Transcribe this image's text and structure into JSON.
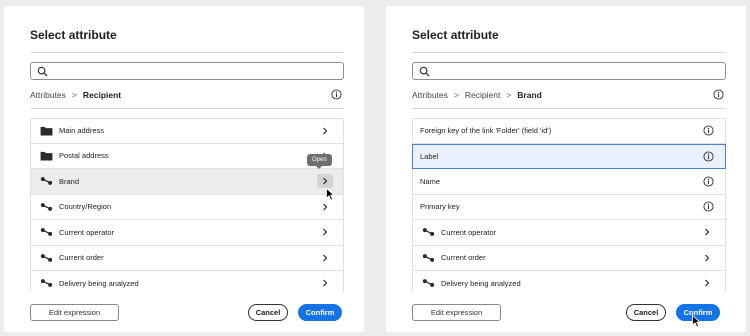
{
  "colors": {
    "accent": "#1473e6",
    "selected_border": "#4a83d4",
    "selected_bg": "#eaf1fc",
    "hover_bg": "#ececec",
    "tooltip_bg": "#6e6e6e"
  },
  "left": {
    "title": "Select attribute",
    "search": {
      "placeholder": "",
      "value": ""
    },
    "breadcrumb": {
      "root": "Attributes",
      "sep": ">",
      "current": "Recipient"
    },
    "items": [
      {
        "label": "Main address",
        "icon": "folder-icon",
        "action": "chevron-right-icon"
      },
      {
        "label": "Postal address",
        "icon": "folder-icon",
        "action": "chevron-right-icon"
      },
      {
        "label": "Brand",
        "icon": "link-icon",
        "action": "chevron-right-icon"
      },
      {
        "label": "Country/Region",
        "icon": "link-icon",
        "action": "chevron-right-icon"
      },
      {
        "label": "Current operator",
        "icon": "link-icon",
        "action": "chevron-right-icon"
      },
      {
        "label": "Current order",
        "icon": "link-icon",
        "action": "chevron-right-icon"
      },
      {
        "label": "Delivery being analyzed",
        "icon": "link-icon",
        "action": "chevron-right-icon"
      }
    ],
    "tooltip": "Open",
    "buttons": {
      "edit": "Edit expression",
      "cancel": "Cancel",
      "confirm": "Confirm"
    }
  },
  "right": {
    "title": "Select attribute",
    "search": {
      "placeholder": "",
      "value": ""
    },
    "breadcrumb": {
      "root": "Attributes",
      "sep": ">",
      "mid": "Recipient",
      "current": "Brand"
    },
    "items": [
      {
        "label": "Foreign key of the link 'Folder' (field 'id')",
        "icon": "",
        "action": "info-icon"
      },
      {
        "label": "Label",
        "icon": "",
        "action": "info-icon"
      },
      {
        "label": "Name",
        "icon": "",
        "action": "info-icon"
      },
      {
        "label": "Primary key",
        "icon": "",
        "action": "info-icon"
      },
      {
        "label": "Current operator",
        "icon": "link-icon",
        "action": "chevron-right-icon"
      },
      {
        "label": "Current order",
        "icon": "link-icon",
        "action": "chevron-right-icon"
      },
      {
        "label": "Delivery being analyzed",
        "icon": "link-icon",
        "action": "chevron-right-icon"
      }
    ],
    "buttons": {
      "edit": "Edit expression",
      "cancel": "Cancel",
      "confirm": "Confirm"
    }
  }
}
